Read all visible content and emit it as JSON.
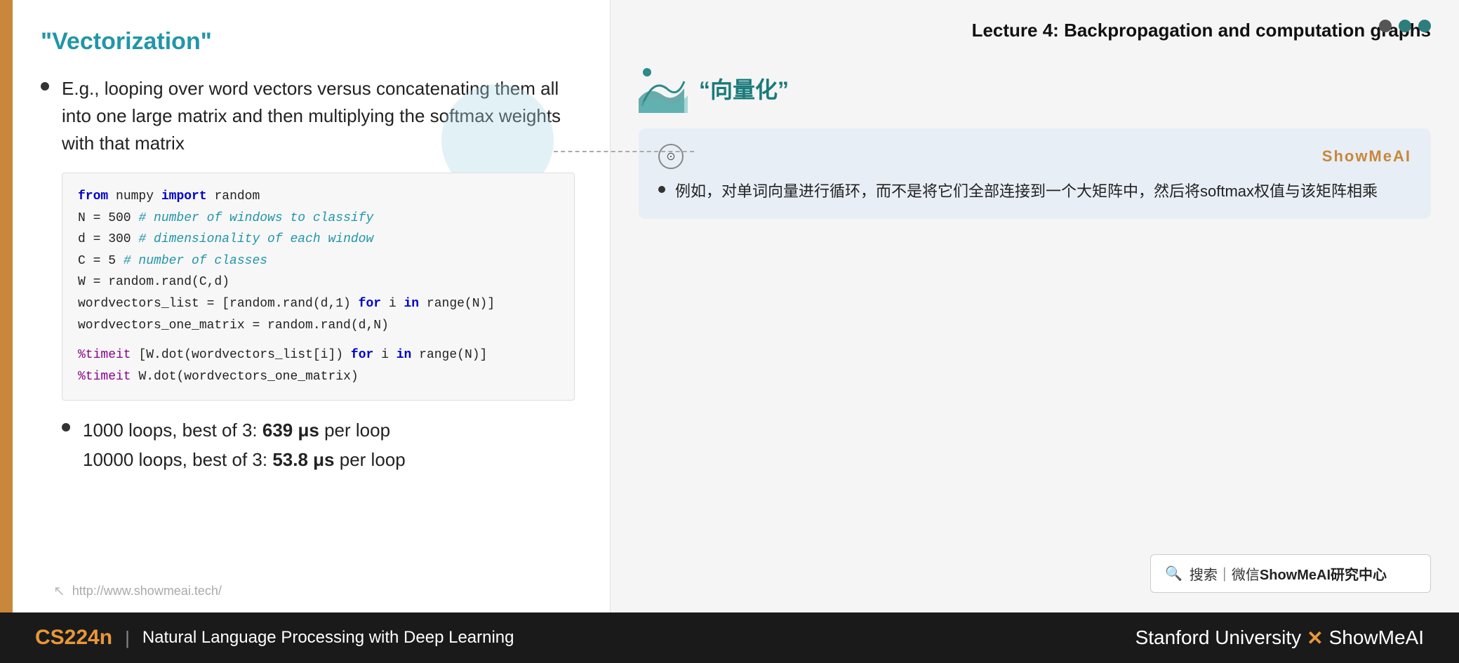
{
  "slide": {
    "left_bar_color": "#c8873a",
    "title": "\"Vectorization\"",
    "bullet1": "E.g., looping over word vectors versus concatenating them all into one large matrix and then multiplying the softmax weights with that matrix",
    "code": {
      "line1_kw": "from",
      "line1_rest": " numpy ",
      "line1_kw2": "import",
      "line1_val": " random",
      "line2": "N = 500 ",
      "line2_comment": "# number of windows to classify",
      "line3": "d = 300 ",
      "line3_comment": "# dimensionality of each window",
      "line4": "C = 5 ",
      "line4_comment": "# number of classes",
      "line5": "W = random.rand(C,d)",
      "line6": "wordvectors_list = [random.rand(d,1) ",
      "line6_kw": "for",
      "line6_mid": " i ",
      "line6_kw2": "in",
      "line6_end": " range(N)]",
      "line7": "wordvectors_one_matrix = random.rand(d,N)",
      "line8_pct": "%timeit",
      "line8_rest": " [W.dot(wordvectors_list[i]) ",
      "line8_kw": "for",
      "line8_mid": " i ",
      "line8_kw2": "in",
      "line8_end": " range(N)]",
      "line9_pct": "%timeit",
      "line9_rest": " W.dot(wordvectors_one_matrix)"
    },
    "perf1_normal": "1000 loops, best of 3:   ",
    "perf1_bold": "639 μs",
    "perf1_end": " per loop",
    "perf2_normal": "10000 loops, best of 3: ",
    "perf2_bold": "53.8 μs",
    "perf2_end": " per loop",
    "footer_url": "http://www.showmeai.tech/"
  },
  "right": {
    "lecture_title": "Lecture 4:  Backpropagation and computation graphs",
    "cn_title": "“向量化”",
    "translation_label": "ShowMeAI",
    "translation_text": "例如，对单词向量进行循环，而不是将它们全部连接到一个大矩阵中，然后将softmax权值与该矩阵相乘",
    "search_text": "搜索｜微信 ",
    "search_brand": "ShowMeAI研究中心"
  },
  "bottom": {
    "course_code": "CS224n",
    "divider": "|",
    "course_name": "Natural Language Processing with Deep Learning",
    "right_text1": "Stanford University",
    "x": "✕",
    "right_text2": "ShowMeAI"
  }
}
